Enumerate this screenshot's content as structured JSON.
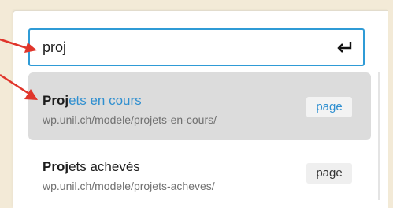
{
  "search": {
    "value": "proj",
    "enter_icon": "return-key-icon"
  },
  "results": [
    {
      "title_match": "Proj",
      "title_rest": "ets en cours",
      "url": "wp.unil.ch/modele/projets-en-cours/",
      "badge": "page",
      "selected": true
    },
    {
      "title_match": "Proj",
      "title_rest": "ets achevés",
      "url": "wp.unil.ch/modele/projets-acheves/",
      "badge": "page",
      "selected": false
    }
  ],
  "annotation": {
    "color": "#e0352b",
    "icon": "red-arrow-icon"
  },
  "colors": {
    "focus_border": "#2f9bd6",
    "highlight_text": "#2f8fd0",
    "selected_row": "#dcdcdc",
    "background": "#f3ead7"
  }
}
